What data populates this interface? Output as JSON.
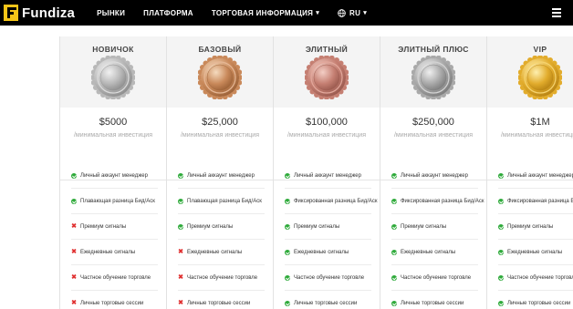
{
  "brand": {
    "name": "Fundiza"
  },
  "nav": {
    "markets": "РЫНКИ",
    "platform": "ПЛАТФОРМА",
    "trading_info": "ТОРГОВАЯ ИНФОРМАЦИЯ",
    "language": "RU"
  },
  "icons": {
    "logo": "fundiza-logo-icon",
    "caret": "chevron-down-icon",
    "globe": "globe-icon",
    "menu": "hamburger-menu-icon",
    "included": "check-circle-icon",
    "excluded": "cross-icon"
  },
  "colors": {
    "accent": "#f5c518",
    "check": "#2eaa3a",
    "cross": "#e03030",
    "header_bg": "#000000"
  },
  "price_note": "/минимальная инвестиция",
  "plans": [
    {
      "name": "НОВИЧОК",
      "price": "$5000",
      "medal": "silver",
      "features": [
        {
          "text": "Личный аккаунт менеджер",
          "included": true
        },
        {
          "text": "Плавающая разница Бид/Аск",
          "included": true
        },
        {
          "text": "Премиум сигналы",
          "included": false
        },
        {
          "text": "Ежедневные сигналы",
          "included": false
        },
        {
          "text": "Частное обучение торговле",
          "included": false
        },
        {
          "text": "Личные торговые сессии",
          "included": false
        }
      ]
    },
    {
      "name": "БАЗОВЫЙ",
      "price": "$25,000",
      "medal": "bronze",
      "features": [
        {
          "text": "Личный аккаунт менеджер",
          "included": true
        },
        {
          "text": "Плавающая разница Бид/Аск",
          "included": true
        },
        {
          "text": "Премиум сигналы",
          "included": true
        },
        {
          "text": "Ежедневные сигналы",
          "included": false
        },
        {
          "text": "Частное обучение торговле",
          "included": false
        },
        {
          "text": "Личные торговые сессии",
          "included": false
        }
      ]
    },
    {
      "name": "ЭЛИТНЫЙ",
      "price": "$100,000",
      "medal": "rose",
      "features": [
        {
          "text": "Личный аккаунт менеджер",
          "included": true
        },
        {
          "text": "Фиксированная разница Бид/Аск",
          "included": true
        },
        {
          "text": "Премиум сигналы",
          "included": true
        },
        {
          "text": "Ежедневные сигналы",
          "included": true
        },
        {
          "text": "Частное обучение торговле",
          "included": true
        },
        {
          "text": "Личные торговые сессии",
          "included": true
        }
      ]
    },
    {
      "name": "ЭЛИТНЫЙ ПЛЮС",
      "price": "$250,000",
      "medal": "platinum",
      "features": [
        {
          "text": "Личный аккаунт менеджер",
          "included": true
        },
        {
          "text": "Фиксированная разница Бид/Аск",
          "included": true
        },
        {
          "text": "Премиум сигналы",
          "included": true
        },
        {
          "text": "Ежедневные сигналы",
          "included": true
        },
        {
          "text": "Частное обучение торговле",
          "included": true
        },
        {
          "text": "Личные торговые сессии",
          "included": true
        }
      ]
    },
    {
      "name": "VIP",
      "price": "$1M",
      "medal": "gold",
      "features": [
        {
          "text": "Личный аккаунт менеджер",
          "included": true
        },
        {
          "text": "Фиксированная разница Бид/Аск",
          "included": true
        },
        {
          "text": "Премиум сигналы",
          "included": true
        },
        {
          "text": "Ежедневные сигналы",
          "included": true
        },
        {
          "text": "Частное обучение торговле",
          "included": true
        },
        {
          "text": "Личные торговые сессии",
          "included": true
        }
      ]
    }
  ]
}
